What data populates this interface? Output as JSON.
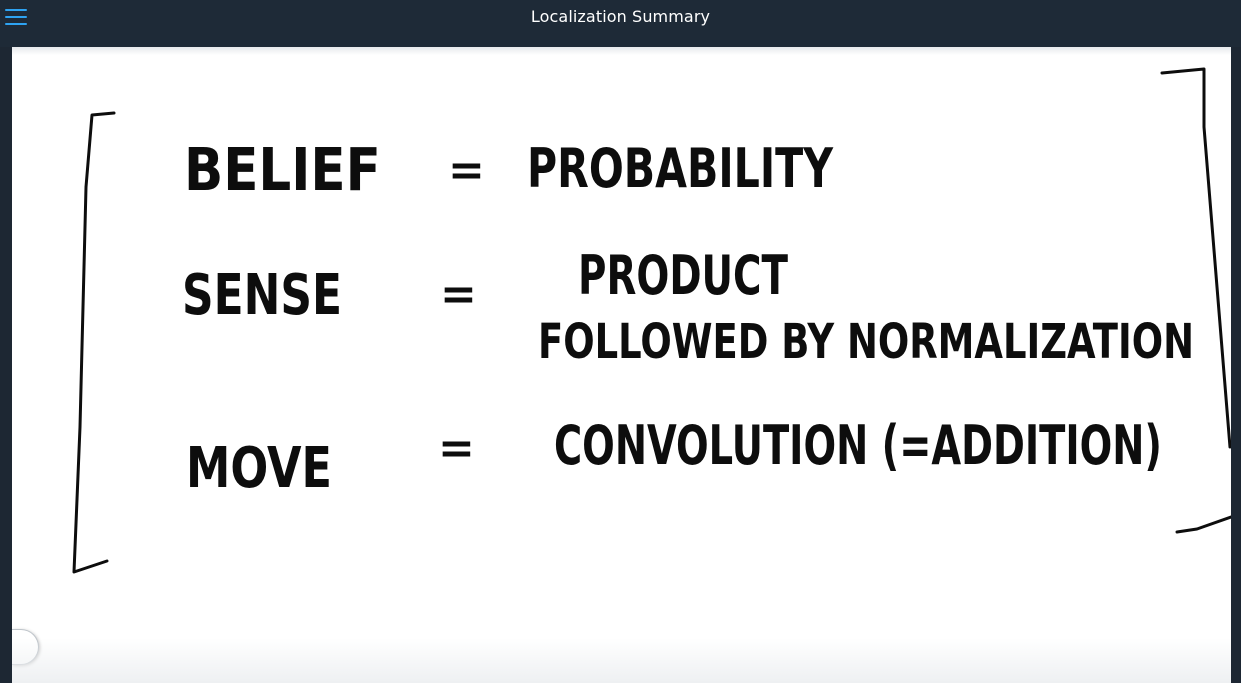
{
  "header": {
    "title": "Localization Summary",
    "menu_icon": "hamburger-menu-icon"
  },
  "whiteboard": {
    "rows": [
      {
        "term": "BELIEF",
        "equals": "=",
        "definition": "PROBABILITY"
      },
      {
        "term": "SENSE",
        "equals": "=",
        "definition": "PRODUCT",
        "definition_line2": "FOLLOWED BY NORMALIZATION"
      },
      {
        "term": "MOVE",
        "equals": "=",
        "definition": "CONVOLUTION (=ADDITION)"
      }
    ]
  },
  "colors": {
    "topbar": "#1e2a37",
    "accent": "#2ea3f2",
    "ink": "#0d0d0d",
    "board": "#ffffff"
  }
}
